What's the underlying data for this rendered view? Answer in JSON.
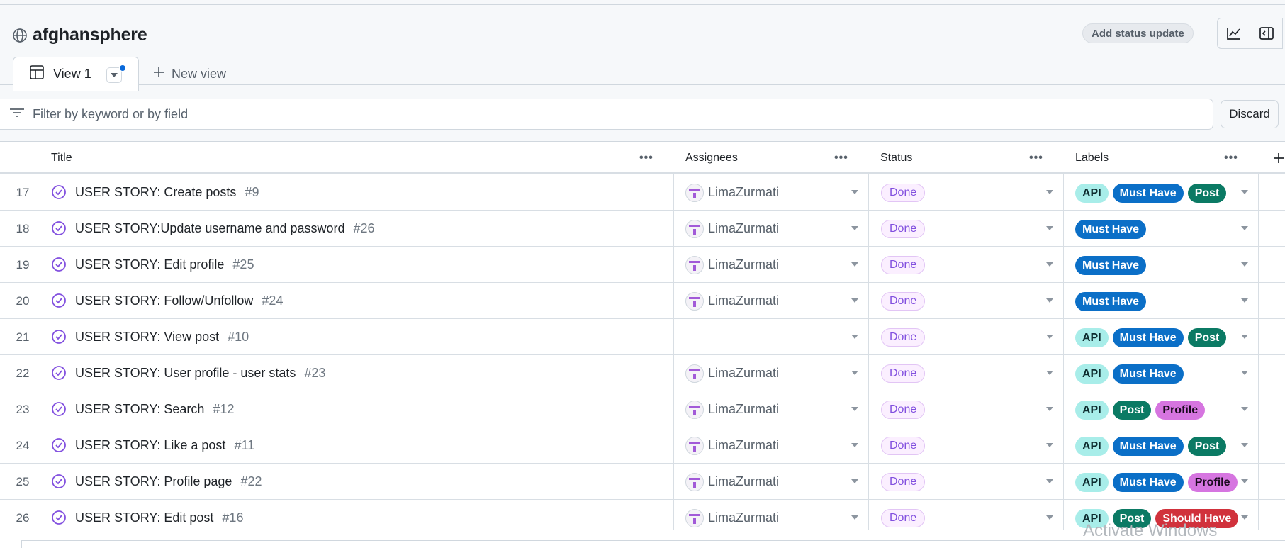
{
  "project": {
    "title": "afghansphere",
    "icon": "globe-icon"
  },
  "header": {
    "status_update_label": "Add status update",
    "icons": [
      "graph-icon",
      "sidebar-collapse-icon"
    ]
  },
  "tabs": {
    "active_label": "View 1",
    "new_view_label": "New view"
  },
  "filter": {
    "placeholder": "Filter by keyword or by field",
    "discard_label": "Discard"
  },
  "columns": {
    "title": "Title",
    "assignees": "Assignees",
    "status": "Status",
    "labels": "Labels"
  },
  "label_colors": {
    "API": {
      "bg": "#a8ede9",
      "fg": "#0d2b2e"
    },
    "Must Have": {
      "bg": "#0b6fc7",
      "fg": "#ffffff"
    },
    "Post": {
      "bg": "#0b7a64",
      "fg": "#ffffff"
    },
    "Profile": {
      "bg": "#d675e0",
      "fg": "#1a0a1e"
    },
    "Should Have": {
      "bg": "#d1323c",
      "fg": "#ffffff"
    }
  },
  "rows": [
    {
      "num": "17",
      "title": "USER STORY: Create posts",
      "issue": "#9",
      "assignee": "LimaZurmati",
      "status": "Done",
      "labels": [
        "API",
        "Must Have",
        "Post"
      ]
    },
    {
      "num": "18",
      "title": "USER STORY:Update username and password",
      "issue": "#26",
      "assignee": "LimaZurmati",
      "status": "Done",
      "labels": [
        "Must Have"
      ]
    },
    {
      "num": "19",
      "title": "USER STORY: Edit profile",
      "issue": "#25",
      "assignee": "LimaZurmati",
      "status": "Done",
      "labels": [
        "Must Have"
      ]
    },
    {
      "num": "20",
      "title": "USER STORY: Follow/Unfollow",
      "issue": "#24",
      "assignee": "LimaZurmati",
      "status": "Done",
      "labels": [
        "Must Have"
      ]
    },
    {
      "num": "21",
      "title": "USER STORY: View post",
      "issue": "#10",
      "assignee": "",
      "status": "Done",
      "labels": [
        "API",
        "Must Have",
        "Post"
      ]
    },
    {
      "num": "22",
      "title": "USER STORY: User profile - user stats",
      "issue": "#23",
      "assignee": "LimaZurmati",
      "status": "Done",
      "labels": [
        "API",
        "Must Have"
      ]
    },
    {
      "num": "23",
      "title": "USER STORY: Search",
      "issue": "#12",
      "assignee": "LimaZurmati",
      "status": "Done",
      "labels": [
        "API",
        "Post",
        "Profile"
      ]
    },
    {
      "num": "24",
      "title": "USER STORY: Like a post",
      "issue": "#11",
      "assignee": "LimaZurmati",
      "status": "Done",
      "labels": [
        "API",
        "Must Have",
        "Post"
      ]
    },
    {
      "num": "25",
      "title": "USER STORY: Profile page",
      "issue": "#22",
      "assignee": "LimaZurmati",
      "status": "Done",
      "labels": [
        "API",
        "Must Have",
        "Profile"
      ]
    },
    {
      "num": "26",
      "title": "USER STORY: Edit post",
      "issue": "#16",
      "assignee": "LimaZurmati",
      "status": "Done",
      "labels": [
        "API",
        "Post",
        "Should Have"
      ]
    }
  ],
  "watermark": "Activate Windows"
}
